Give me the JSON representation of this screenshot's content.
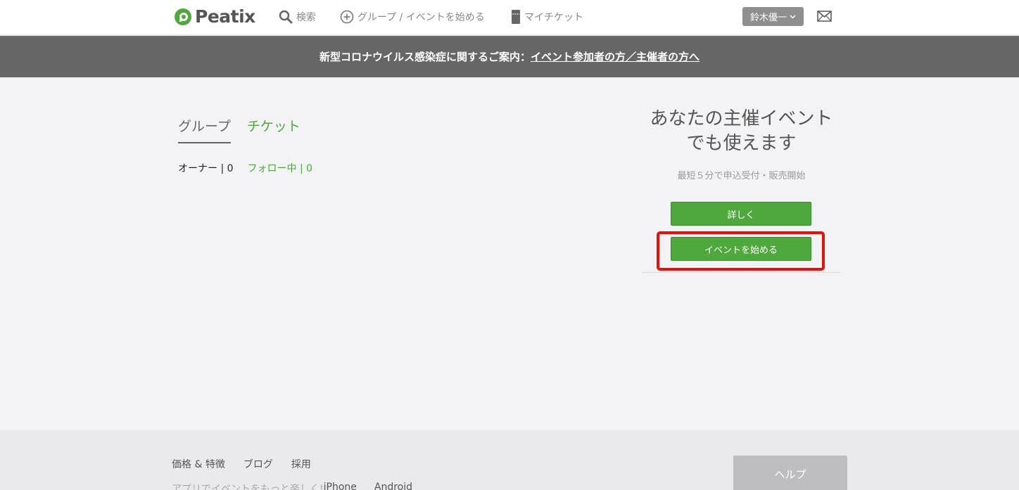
{
  "header": {
    "logo_text": "Peatix",
    "nav": {
      "search": "検索",
      "start": "グループ / イベントを始める",
      "my_ticket": "マイチケット"
    },
    "user_name": "鈴木優一"
  },
  "banner": {
    "prefix": "新型コロナウイルス感染症に関するご案内：",
    "link": "イベント参加者の方／主催者の方へ"
  },
  "main": {
    "tabs": [
      {
        "label": "グループ",
        "active": true
      },
      {
        "label": "チケット",
        "active": false
      }
    ],
    "owner_count": "オーナー | 0",
    "following_count": "フォロー中 | 0"
  },
  "promo": {
    "title_line1": "あなたの主催イベント",
    "title_line2": "でも使えます",
    "subtitle": "最短５分で申込受付・販売開始",
    "details_button": "詳しく",
    "start_button": "イベントを始める"
  },
  "footer": {
    "links": [
      "価格 & 特徴",
      "ブログ",
      "採用"
    ],
    "app_text": "アプリでイベントをもっと楽しく!",
    "iphone": "iPhone",
    "android": "Android",
    "help": "ヘルプ"
  },
  "colors": {
    "brand_green": "#4ea83c",
    "banner_bg": "#666666",
    "highlight_red": "#e0140f"
  }
}
